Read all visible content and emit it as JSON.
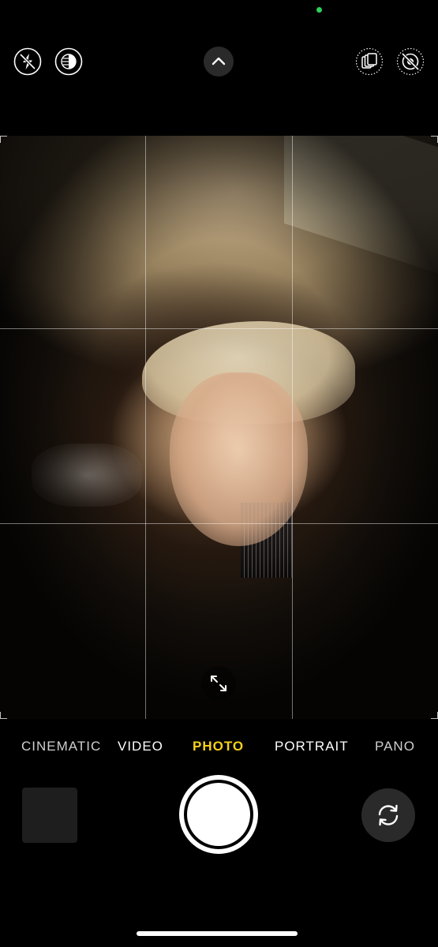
{
  "status": {
    "indicator_color": "#2fd158"
  },
  "top_controls": {
    "flash": {
      "icon": "flash-off-icon",
      "state": "off"
    },
    "night_mode": {
      "icon": "night-mode-icon"
    },
    "controls_toggle": {
      "icon": "chevron-up-icon"
    },
    "live_photo": {
      "icon": "live-photo-icon"
    },
    "styles": {
      "icon": "photographic-styles-off-icon"
    }
  },
  "viewfinder": {
    "grid": "on",
    "expand_icon": "expand-arrows-icon"
  },
  "modes": {
    "items": [
      "CINEMATIC",
      "VIDEO",
      "PHOTO",
      "PORTRAIT",
      "PANO"
    ],
    "selected": "PHOTO",
    "selected_color": "#f7d01d"
  },
  "bottom_controls": {
    "thumbnail": {
      "icon": "last-photo-thumbnail"
    },
    "shutter": {
      "icon": "shutter-icon"
    },
    "flip_camera": {
      "icon": "camera-flip-icon"
    }
  }
}
